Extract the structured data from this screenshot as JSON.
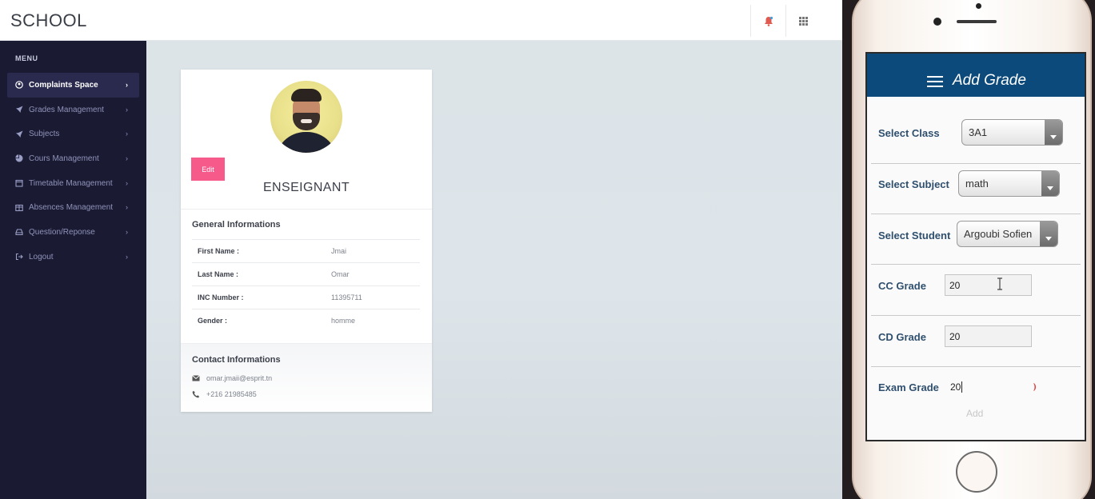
{
  "web": {
    "brand": "SCHOOL",
    "menu_title": "MENU",
    "menu": [
      {
        "label": "Complaints Space",
        "icon": "user-circle-icon",
        "active": true
      },
      {
        "label": "Grades Management",
        "icon": "rocket-icon"
      },
      {
        "label": "Subjects",
        "icon": "rocket-icon"
      },
      {
        "label": "Cours Management",
        "icon": "pie-chart-icon"
      },
      {
        "label": "Timetable Management",
        "icon": "calendar-icon"
      },
      {
        "label": "Absences Management",
        "icon": "table-icon"
      },
      {
        "label": "Question/Reponse",
        "icon": "inbox-icon"
      },
      {
        "label": "Logout",
        "icon": "sign-out-icon"
      }
    ],
    "profile": {
      "edit_label": "Edit",
      "role": "ENSEIGNANT",
      "general_title": "General Informations",
      "fields": [
        {
          "key": "First Name :",
          "value": "Jmai"
        },
        {
          "key": "Last Name :",
          "value": "Omar"
        },
        {
          "key": "INC Number :",
          "value": "11395711"
        },
        {
          "key": "Gender :",
          "value": "homme"
        }
      ],
      "contact_title": "Contact Informations",
      "email": "omar.jmaii@esprit.tn",
      "phone": "+216 21985485"
    },
    "colors": {
      "sidebar": "#1a1a33",
      "edit": "#f55a8a",
      "accent_bell": "#e05a4f"
    }
  },
  "mobile": {
    "title": "Add Grade",
    "select_class_label": "Select Class",
    "select_class_value": "3A1",
    "select_subject_label": "Select Subject",
    "select_subject_value": "math",
    "select_student_label": "Select Student",
    "select_student_value": "Argoubi Sofien",
    "cc_label": "CC Grade",
    "cc_value": "20",
    "cd_label": "CD Grade",
    "cd_value": "20",
    "exam_label": "Exam Grade",
    "exam_value": "20",
    "add_label": "Add",
    "header_color": "#0d4a7c"
  }
}
